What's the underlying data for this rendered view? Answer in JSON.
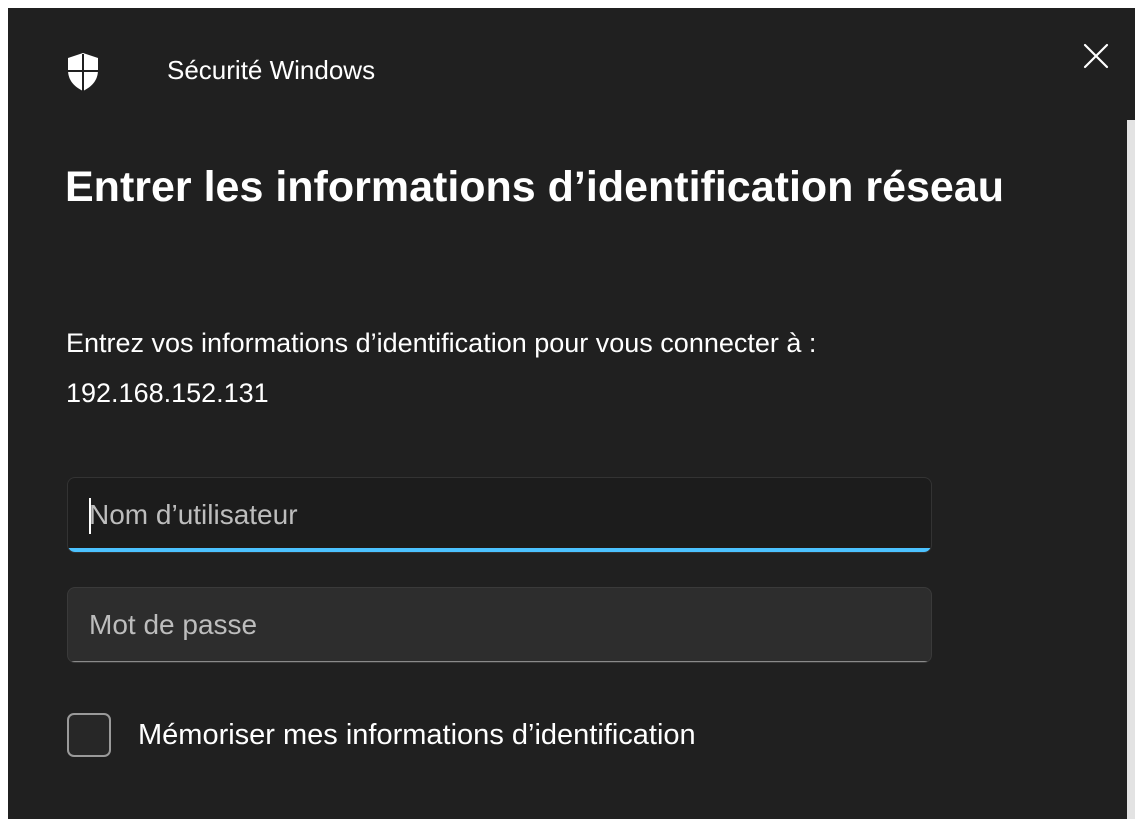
{
  "titlebar": {
    "app_title": "Sécurité Windows",
    "icon": "shield-icon",
    "close_icon": "close-icon"
  },
  "dialog": {
    "heading": "Entrer les informations d’identification réseau",
    "message_line1": "Entrez vos informations d’identification pour vous connecter à :",
    "message_line2": "192.168.152.131"
  },
  "form": {
    "username_placeholder": "Nom d’utilisateur",
    "username_value": "",
    "password_placeholder": "Mot de passe",
    "password_value": "",
    "remember_label": "Mémoriser mes informations d’identification",
    "remember_checked": false
  },
  "colors": {
    "background": "#202020",
    "accent": "#4cc2ff",
    "text": "#ffffff"
  }
}
